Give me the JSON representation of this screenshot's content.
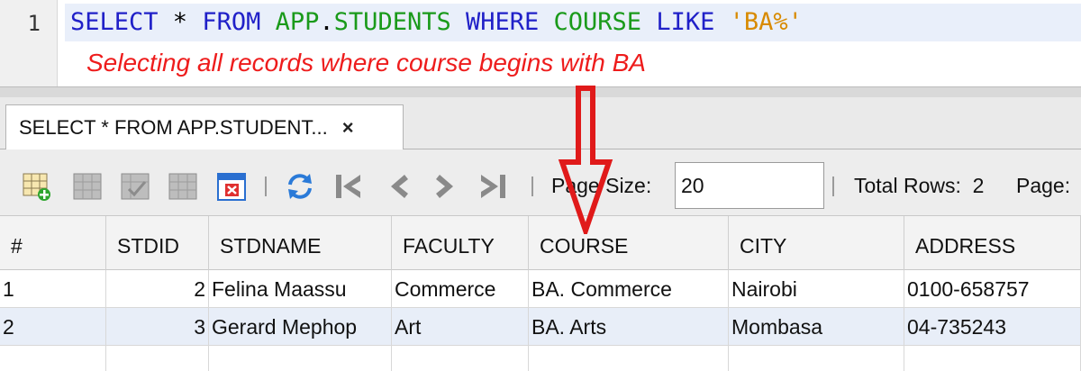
{
  "editor": {
    "line_number": "1",
    "query": {
      "select": "SELECT",
      "star": " * ",
      "from": "FROM",
      "space1": " ",
      "schema": "APP",
      "dot": ".",
      "table": "STUDENTS",
      "space2": " ",
      "where": "WHERE",
      "space3": " ",
      "column": "COURSE",
      "space4": " ",
      "like": "LIKE",
      "space5": " ",
      "pattern": "'BA%'"
    },
    "annotation": "Selecting all records where course begins with BA"
  },
  "result_tab": {
    "label": "SELECT * FROM APP.STUDENT...",
    "close": "×"
  },
  "toolbar": {
    "icons": [
      "insert-record-icon",
      "delete-record-icon",
      "commit-record-icon",
      "cancel-edits-icon",
      "truncate-table-icon",
      "refresh-icon",
      "first-page-icon",
      "previous-page-icon",
      "next-page-icon",
      "last-page-icon"
    ],
    "page_size_label": "Page Size:",
    "page_size_value": "20",
    "total_rows_label": "Total Rows:",
    "total_rows_value": "2",
    "page_label": "Page:"
  },
  "grid": {
    "columns": [
      "#",
      "STDID",
      "STDNAME",
      "FACULTY",
      "COURSE",
      "CITY",
      "ADDRESS"
    ],
    "rows": [
      [
        "1",
        "2",
        "Felina Maassu",
        "Commerce",
        "BA. Commerce",
        "Nairobi",
        "0100-658757"
      ],
      [
        "2",
        "3",
        "Gerard Mephop",
        "Art",
        "BA. Arts",
        "Mombasa",
        "04-735243"
      ]
    ]
  },
  "colors": {
    "keyword": "#2020c8",
    "object": "#1a9a1a",
    "string": "#d88a00",
    "annotation": "#ee1c1c",
    "alt_row": "#e8eef8"
  }
}
